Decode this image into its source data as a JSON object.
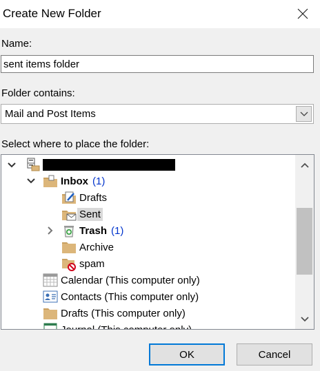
{
  "dialog": {
    "title": "Create New Folder",
    "name_label": "Name:",
    "name_value": "sent items folder",
    "contains_label": "Folder contains:",
    "contains_value": "Mail and Post Items",
    "place_label": "Select where to place the folder:",
    "ok_label": "OK",
    "cancel_label": "Cancel"
  },
  "tree": {
    "inbox": {
      "label": "Inbox",
      "count": "(1)"
    },
    "drafts": {
      "label": "Drafts"
    },
    "sent": {
      "label": "Sent"
    },
    "trash": {
      "label": "Trash",
      "count": "(1)"
    },
    "archive": {
      "label": "Archive"
    },
    "spam": {
      "label": "spam"
    },
    "calendar": {
      "label": "Calendar (This computer only)"
    },
    "contacts": {
      "label": "Contacts (This computer only)"
    },
    "drafts_local": {
      "label": "Drafts (This computer only)"
    },
    "journal": {
      "label": "Journal (This computer only)"
    }
  },
  "colors": {
    "accent": "#0078d7",
    "count": "#0033cc",
    "folder": "#dcb67a",
    "selection": "#d9d9d9"
  }
}
